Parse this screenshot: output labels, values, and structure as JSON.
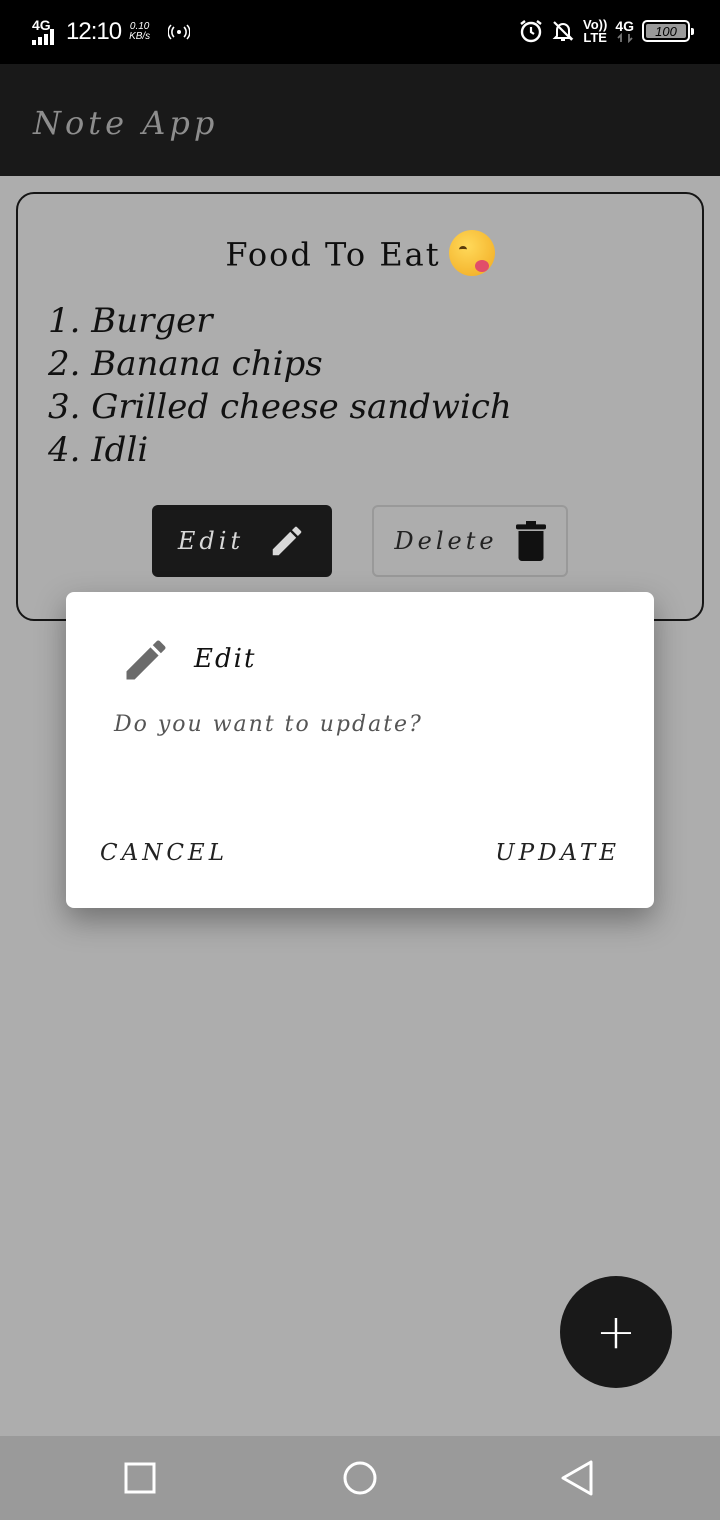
{
  "status_bar": {
    "network_type": "4G",
    "time": "12:10",
    "speed_value": "0.10",
    "speed_unit": "KB/s",
    "volte_line1": "Vo))",
    "volte_line2": "LTE",
    "data_type": "4G",
    "battery": "100"
  },
  "app_bar": {
    "title": "Note App"
  },
  "note": {
    "title": "Food To Eat",
    "items": [
      "1. Burger",
      "2. Banana chips",
      "3. Grilled cheese sandwich",
      "4. Idli"
    ],
    "edit_label": "Edit",
    "delete_label": "Delete"
  },
  "dialog": {
    "title": "Edit",
    "message": "Do you want to update?",
    "cancel_label": "CANCEL",
    "confirm_label": "UPDATE"
  },
  "fab": {
    "label": "+"
  },
  "icons": {
    "edit": "pencil-icon",
    "delete": "trash-icon",
    "dialog": "pencil-icon",
    "nav_recents": "square-icon",
    "nav_home": "circle-icon",
    "nav_back": "triangle-back-icon"
  },
  "colors": {
    "app_bar_bg": "#191919",
    "screen_scrim": "#adadad",
    "dialog_bg": "#ffffff"
  }
}
